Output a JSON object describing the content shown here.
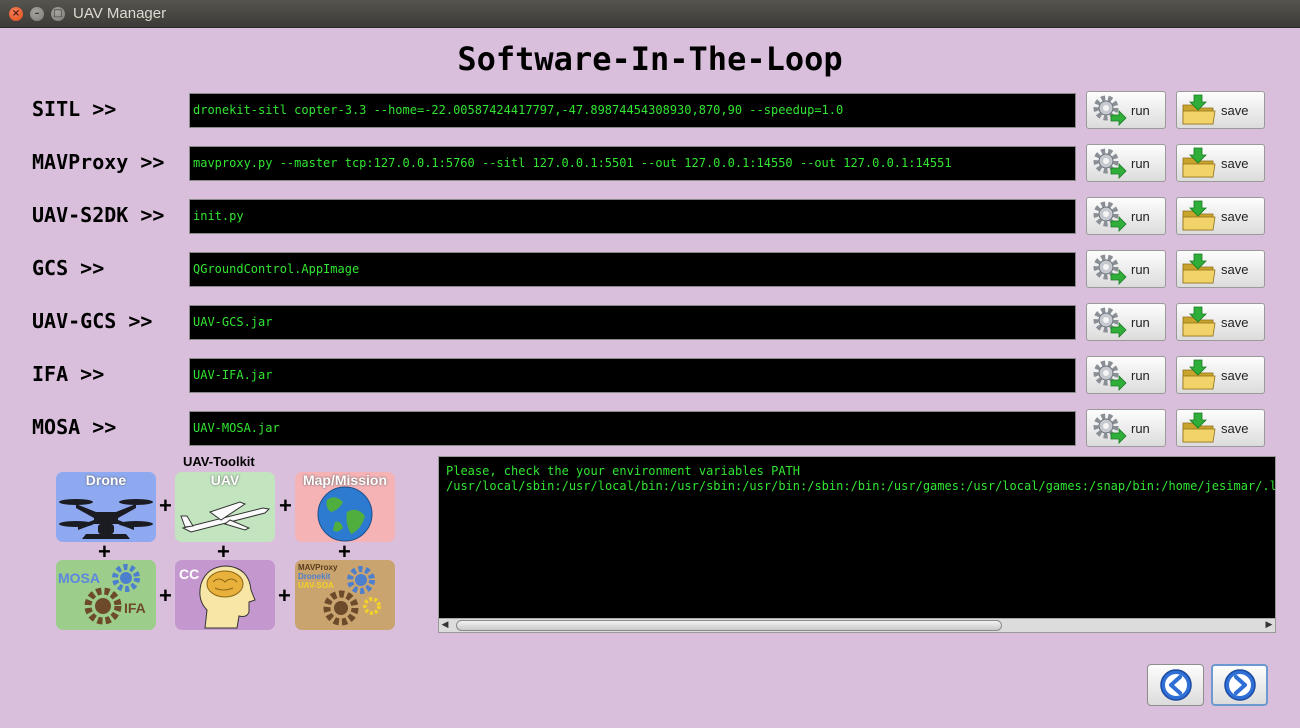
{
  "window": {
    "title": "UAV Manager"
  },
  "page": {
    "title": "Software-In-The-Loop"
  },
  "rows": [
    {
      "label": "SITL >>",
      "command": "dronekit-sitl copter-3.3 --home=-22.00587424417797,-47.89874454308930,870,90 --speedup=1.0",
      "run_label": "run",
      "save_label": "save"
    },
    {
      "label": "MAVProxy >>",
      "command": "mavproxy.py --master tcp:127.0.0.1:5760 --sitl 127.0.0.1:5501 --out 127.0.0.1:14550 --out 127.0.0.1:14551",
      "run_label": "run",
      "save_label": "save"
    },
    {
      "label": "UAV-S2DK >>",
      "command": "init.py",
      "run_label": "run",
      "save_label": "save"
    },
    {
      "label": "GCS >>",
      "command": "QGroundControl.AppImage",
      "run_label": "run",
      "save_label": "save"
    },
    {
      "label": "UAV-GCS >>",
      "command": "UAV-GCS.jar",
      "run_label": "run",
      "save_label": "save"
    },
    {
      "label": "IFA >>",
      "command": "UAV-IFA.jar",
      "run_label": "run",
      "save_label": "save"
    },
    {
      "label": "MOSA >>",
      "command": "UAV-MOSA.jar",
      "run_label": "run",
      "save_label": "save"
    }
  ],
  "toolkit": {
    "title": "UAV-Toolkit",
    "tiles": {
      "drone": "Drone",
      "uav": "UAV",
      "map": "Map/Mission",
      "mosa": "MOSA",
      "ifa": "IFA",
      "cc": "CC",
      "mavproxy": "MAVProxy",
      "dronekit": "Dronekit",
      "uavsoa": "UAV-SOA"
    },
    "plus": "+"
  },
  "console": {
    "line1": "Please, check the your environment variables PATH",
    "line2": "/usr/local/sbin:/usr/local/bin:/usr/sbin:/usr/bin:/sbin:/bin:/usr/games:/usr/local/games:/snap/bin:/home/jesimar/.local"
  },
  "icons": {
    "run": "gear-run-icon",
    "save": "folder-download-icon",
    "back": "arrow-left-icon",
    "next": "arrow-right-icon"
  },
  "colors": {
    "background": "#dabfdd",
    "terminal_text": "#31e531",
    "terminal_bg": "#000000"
  }
}
